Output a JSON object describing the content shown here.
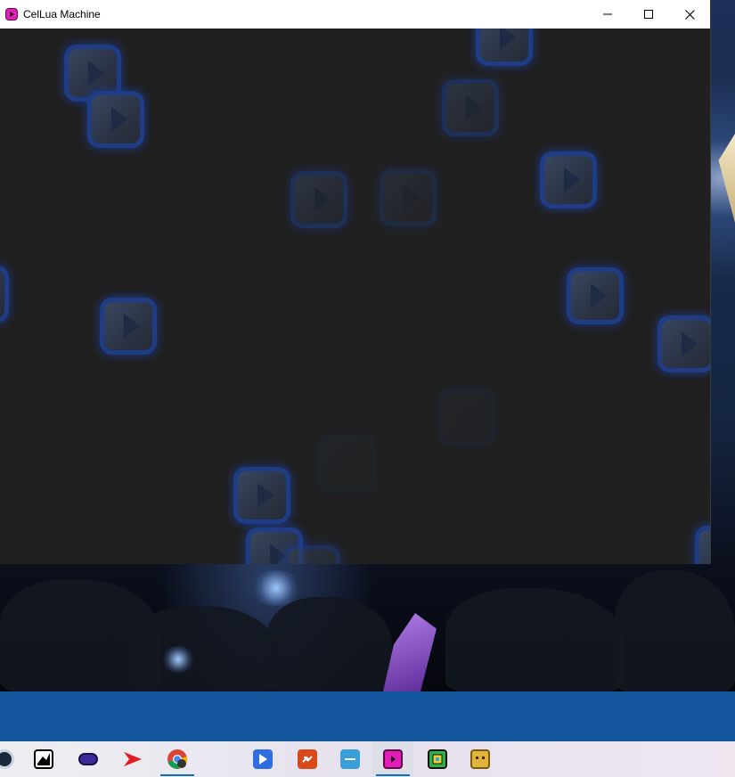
{
  "window": {
    "title": "CelLua Machine",
    "app_icon": "cellua-app-icon",
    "controls": [
      "minimize-icon",
      "maximize-icon",
      "close-icon"
    ]
  },
  "taskbar": {
    "pinned_apps": [
      {
        "name": "steam-icon",
        "color": "#1b2838"
      },
      {
        "name": "inkscape-icon",
        "color": "#000000"
      },
      {
        "name": "gamepad-app-icon",
        "color": "#3b2a9c"
      },
      {
        "name": "red-arrow-app-icon",
        "color": "#e01c24"
      },
      {
        "name": "chrome-icon",
        "color": "#4285f4"
      },
      {
        "name": "video-editor-icon",
        "color": "#2f6ee0"
      },
      {
        "name": "transfer-app-icon",
        "color": "#d84a1c"
      },
      {
        "name": "tpc-app-icon",
        "color": "#3a9ed8"
      },
      {
        "name": "cellua-taskbar-icon",
        "color": "#e51db8"
      },
      {
        "name": "geometry-dash-icon",
        "color": "#2eb04a"
      },
      {
        "name": "cube-game-icon",
        "color": "#e0b43a"
      }
    ]
  },
  "colors": {
    "canvas_bg": "#202020",
    "cell_border": "#1e3d86",
    "taskbar_band": "#13569e"
  }
}
